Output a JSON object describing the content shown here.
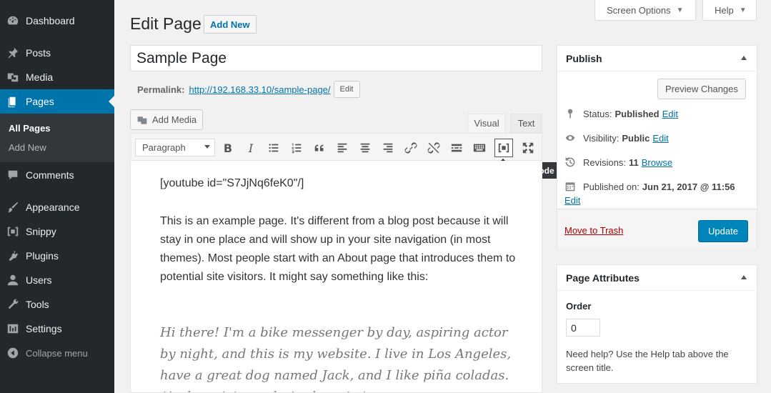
{
  "sidebar": {
    "items": [
      {
        "label": "Dashboard",
        "icon": "dashboard-icon"
      },
      {
        "label": "Posts",
        "icon": "pin-icon"
      },
      {
        "label": "Media",
        "icon": "media-icon"
      },
      {
        "label": "Pages",
        "icon": "page-icon"
      },
      {
        "label": "Comments",
        "icon": "comment-icon"
      },
      {
        "label": "Appearance",
        "icon": "brush-icon"
      },
      {
        "label": "Snippy",
        "icon": "snippy-icon"
      },
      {
        "label": "Plugins",
        "icon": "plug-icon"
      },
      {
        "label": "Users",
        "icon": "user-icon"
      },
      {
        "label": "Tools",
        "icon": "wrench-icon"
      },
      {
        "label": "Settings",
        "icon": "settings-icon"
      }
    ],
    "submenu": [
      "All Pages",
      "Add New"
    ],
    "collapse_label": "Collapse menu",
    "accent": "#0073aa"
  },
  "top": {
    "screen_options": "Screen Options",
    "help": "Help"
  },
  "header": {
    "title": "Edit Page",
    "add_new": "Add New"
  },
  "editor": {
    "title_value": "Sample Page",
    "permalink_label": "Permalink:",
    "permalink_url": "http://192.168.33.10/sample-page/",
    "permalink_edit": "Edit",
    "add_media": "Add Media",
    "tab_visual": "Visual",
    "tab_text": "Text",
    "format": "Paragraph",
    "tooltip": "Insert Snippy Shortcode",
    "shortcode": "[youtube id=\"S7JjNq6feK0\"/]",
    "paragraph": "This is an example page. It's different from a blog post because it will stay in one place and will show up in your site navigation (in most themes). Most people start with an About page that introduces them to potential site visitors. It might say something like this:",
    "quote": "Hi there! I'm a bike messenger by day, aspiring actor by night, and this is my website. I live in Los Angeles, have a great dog named Jack, and I like piña coladas. (And gettin' caught in the rain.)"
  },
  "publish": {
    "title": "Publish",
    "preview": "Preview Changes",
    "status_label": "Status:",
    "status_value": "Published",
    "visibility_label": "Visibility:",
    "visibility_value": "Public",
    "revisions_label": "Revisions:",
    "revisions_value": "11",
    "browse": "Browse",
    "published_label": "Published on:",
    "published_value": "Jun 21, 2017 @ 11:56",
    "edit": "Edit",
    "trash": "Move to Trash",
    "update": "Update"
  },
  "attributes": {
    "title": "Page Attributes",
    "order_label": "Order",
    "order_value": "0",
    "help_text": "Need help? Use the Help tab above the screen title."
  }
}
